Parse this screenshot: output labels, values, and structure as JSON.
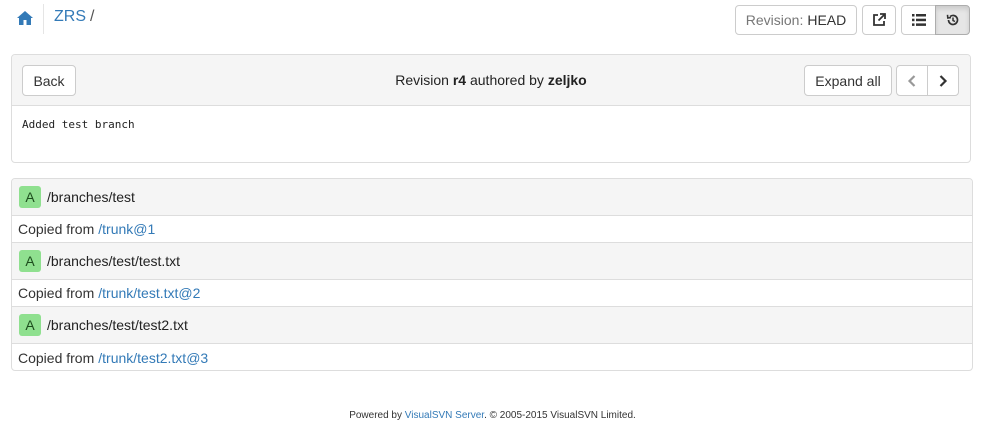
{
  "breadcrumb": {
    "repo": "ZRS",
    "separator": "/"
  },
  "toolbar": {
    "revision_label": "Revision:",
    "revision_value": "HEAD"
  },
  "panel": {
    "back_label": "Back",
    "title_prefix": "Revision",
    "revision": "r4",
    "title_middle": "authored by",
    "author": "zeljko",
    "expand_label": "Expand all",
    "commit_message": "Added test branch"
  },
  "changes": [
    {
      "action": "A",
      "path": "/branches/test",
      "copied_label": "Copied from",
      "copied_from": "/trunk@1"
    },
    {
      "action": "A",
      "path": "/branches/test/test.txt",
      "copied_label": "Copied from",
      "copied_from": "/trunk/test.txt@2"
    },
    {
      "action": "A",
      "path": "/branches/test/test2.txt",
      "copied_label": "Copied from",
      "copied_from": "/trunk/test2.txt@3"
    }
  ],
  "footer": {
    "prefix": "Powered by",
    "product": "VisualSVN Server",
    "suffix": ". © 2005-2015 VisualSVN Limited."
  },
  "colors": {
    "link": "#337ab7",
    "added_badge": "#8fe08f",
    "panel_header": "#f5f5f5"
  },
  "icons": [
    "home-icon",
    "external-link-icon",
    "list-icon",
    "history-icon",
    "chevron-left-icon",
    "chevron-right-icon"
  ]
}
